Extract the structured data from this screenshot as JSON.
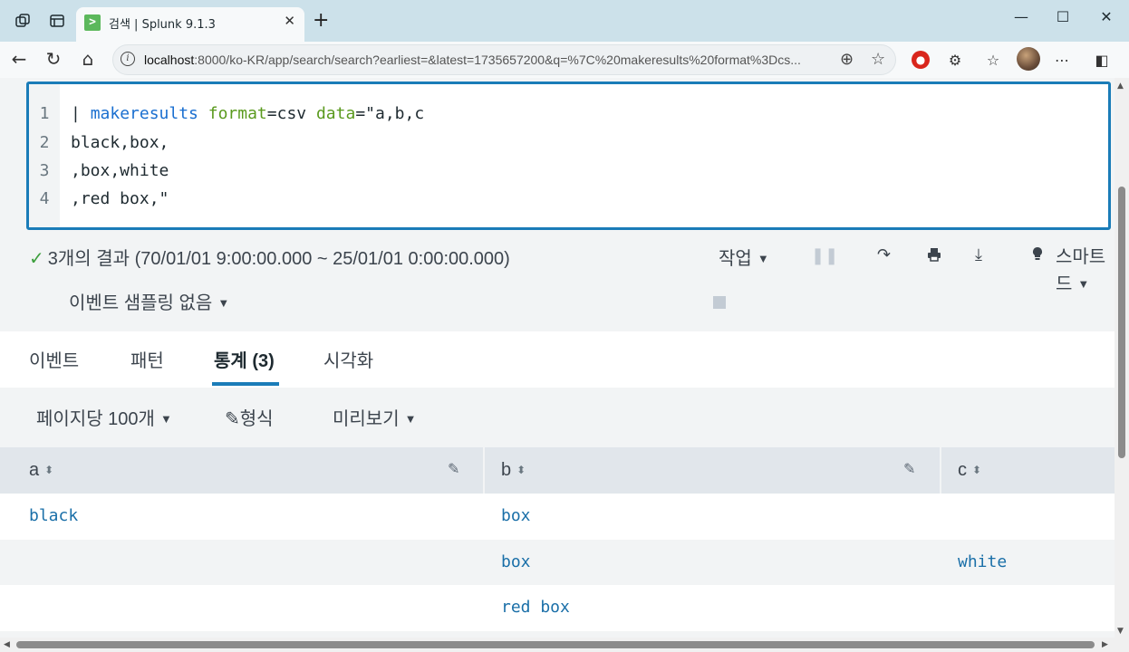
{
  "browser": {
    "tab_title": "검색 | Splunk 9.1.3",
    "tab_favicon": ">",
    "url_host": "localhost",
    "url_rest": ":8000/ko-KR/app/search/search?earliest=&latest=1735657200&q=%7C%20makeresults%20format%3Dcs...",
    "icons": [
      "workspaces-icon",
      "tab-actions-icon",
      "back-icon",
      "reload-icon",
      "home-icon",
      "site-info-icon",
      "zoom-icon",
      "favorite-icon",
      "adblock-icon",
      "extensions-icon",
      "favorites-icon",
      "profile-avatar",
      "more-icon",
      "sidebar-icon"
    ]
  },
  "editor": {
    "line_numbers": [
      "1",
      "2",
      "3",
      "4"
    ],
    "line1": {
      "pipe": "| ",
      "cmd": "makeresults",
      "sp1": " ",
      "arg1": "format",
      "eq1": "=csv ",
      "arg2": "data",
      "rest": "=\"a,b,c"
    },
    "line2": "black,box,",
    "line3": ",box,white",
    "line4": ",red box,\""
  },
  "status": {
    "result_text": "3개의 결과 (70/01/01 9:00:00.000 ~ 25/01/01 0:00:00.000)",
    "sampling": "이벤트 샘플링 없음",
    "job_menu": "작업",
    "smart_mode_line1": "스마트",
    "smart_mode_line2": "드"
  },
  "tabs": [
    {
      "label": "이벤트"
    },
    {
      "label": "패턴"
    },
    {
      "label": "통계 (3)"
    },
    {
      "label": "시각화"
    }
  ],
  "options": {
    "per_page": "페이지당 100개",
    "format": "형식",
    "preview": "미리보기"
  },
  "table": {
    "columns": [
      "a",
      "b",
      "c"
    ],
    "rows": [
      [
        "black",
        "box",
        ""
      ],
      [
        "",
        "box",
        "white"
      ],
      [
        "",
        "red box",
        ""
      ]
    ]
  },
  "colors": {
    "accent": "#1a7cb8",
    "link": "#1a6fa8",
    "keyword": "#1a6fd0",
    "argument": "#5a9a1e"
  }
}
